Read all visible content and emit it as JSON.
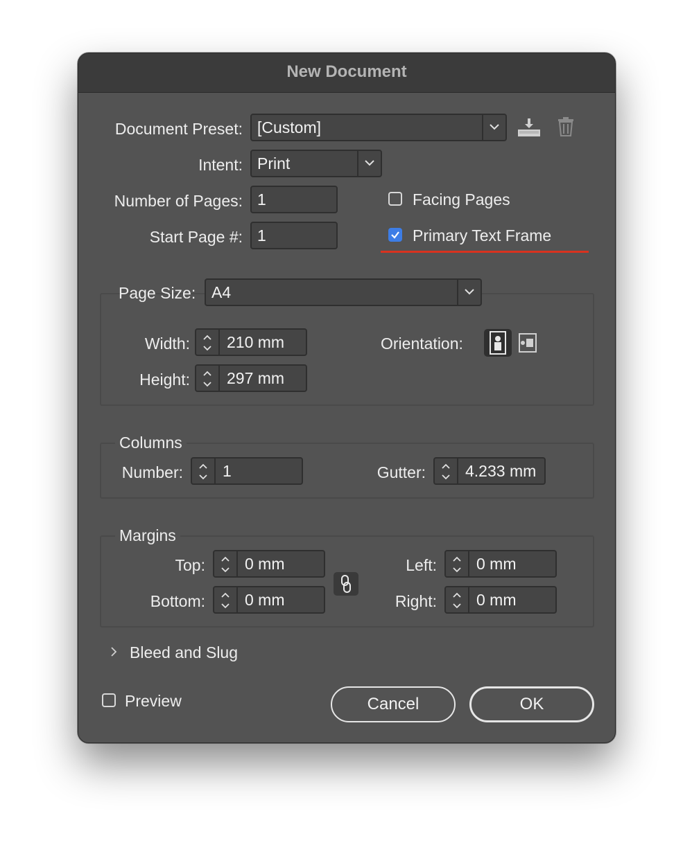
{
  "dialog": {
    "title": "New Document"
  },
  "preset": {
    "label": "Document Preset:",
    "value": "[Custom]"
  },
  "intent": {
    "label": "Intent:",
    "value": "Print"
  },
  "pages": {
    "number_label": "Number of Pages:",
    "number_value": "1",
    "start_label": "Start Page #:",
    "start_value": "1",
    "facing_pages_label": "Facing Pages",
    "facing_pages_checked": false,
    "primary_text_frame_label": "Primary Text Frame",
    "primary_text_frame_checked": true
  },
  "page_size": {
    "label": "Page Size:",
    "value": "A4",
    "width_label": "Width:",
    "width_value": "210 mm",
    "height_label": "Height:",
    "height_value": "297 mm",
    "orientation_label": "Orientation:",
    "orientation_selected": "portrait"
  },
  "columns": {
    "group_label": "Columns",
    "number_label": "Number:",
    "number_value": "1",
    "gutter_label": "Gutter:",
    "gutter_value": "4.233 mm"
  },
  "margins": {
    "group_label": "Margins",
    "top_label": "Top:",
    "top_value": "0 mm",
    "bottom_label": "Bottom:",
    "bottom_value": "0 mm",
    "left_label": "Left:",
    "left_value": "0 mm",
    "right_label": "Right:",
    "right_value": "0 mm"
  },
  "bleed": {
    "label": "Bleed and Slug"
  },
  "footer": {
    "preview_label": "Preview",
    "preview_checked": false,
    "cancel_label": "Cancel",
    "ok_label": "OK"
  },
  "icons": {
    "save_preset": "save-preset-icon",
    "delete_preset": "trash-icon",
    "link_margins": "chain-link-icon",
    "portrait": "portrait-orientation-icon",
    "landscape": "landscape-orientation-icon",
    "disclosure": "chevron-right-icon"
  },
  "colors": {
    "dialog_bg": "#535353",
    "titlebar_bg": "#3b3b3b",
    "field_bg": "#454545",
    "checkbox_accent": "#3d7de6",
    "annotation_underline": "#d9321f"
  }
}
